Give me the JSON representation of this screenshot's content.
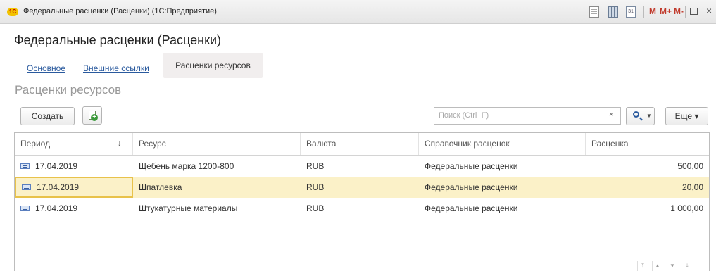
{
  "window": {
    "logo_text": "1С",
    "title": "Федеральные расценки (Расценки)  (1С:Предприятие)",
    "calendar_text": "31",
    "m_label": "M",
    "m_plus_label": "M+",
    "m_minus_label": "M-",
    "close_glyph": "×"
  },
  "form": {
    "title": "Федеральные расценки (Расценки)"
  },
  "tabs": [
    {
      "label": "Основное"
    },
    {
      "label": "Внешние ссылки"
    },
    {
      "label": "Расценки ресурсов"
    }
  ],
  "section": {
    "title": "Расценки ресурсов"
  },
  "toolbar": {
    "create_label": "Создать",
    "search_placeholder": "Поиск (Ctrl+F)",
    "search_clear": "×",
    "more_label": "Еще ▾"
  },
  "table": {
    "columns": [
      "Период",
      "Ресурс",
      "Валюта",
      "Справочник расценок",
      "Расценка"
    ],
    "sort_indicator": "↓",
    "rows": [
      {
        "period": "17.04.2019",
        "resource": "Щебень марка 1200-800",
        "currency": "RUB",
        "catalog": "Федеральные расценки",
        "price": "500,00"
      },
      {
        "period": "17.04.2019",
        "resource": "Шпатлевка",
        "currency": "RUB",
        "catalog": "Федеральные расценки",
        "price": "20,00"
      },
      {
        "period": "17.04.2019",
        "resource": "Штукатурные материалы",
        "currency": "RUB",
        "catalog": "Федеральные расценки",
        "price": "1 000,00"
      }
    ],
    "selected_row": 2
  },
  "colors": {
    "accent_link": "#2a5a9e",
    "selected_row": "#fbf1c8",
    "selected_border": "#e8c24a"
  }
}
